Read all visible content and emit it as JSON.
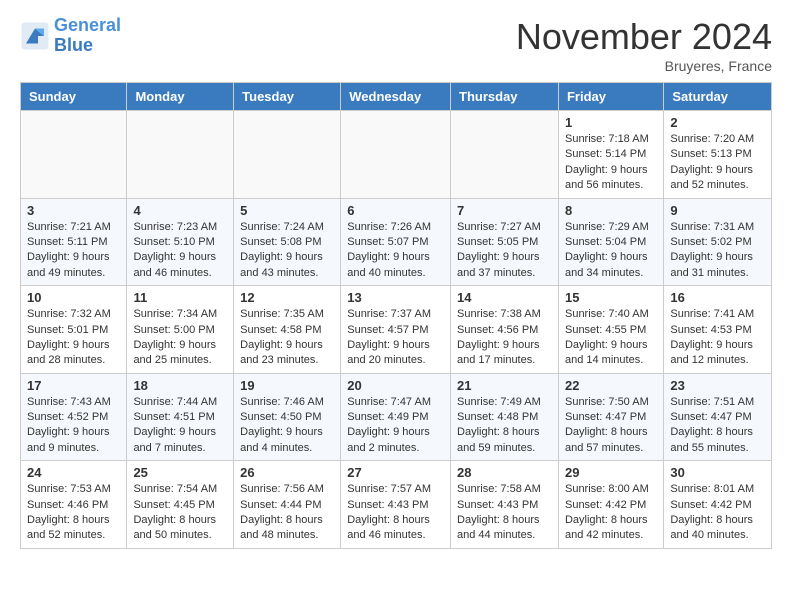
{
  "header": {
    "logo_line1": "General",
    "logo_line2": "Blue",
    "month": "November 2024",
    "location": "Bruyeres, France"
  },
  "weekdays": [
    "Sunday",
    "Monday",
    "Tuesday",
    "Wednesday",
    "Thursday",
    "Friday",
    "Saturday"
  ],
  "weeks": [
    [
      {
        "day": "",
        "info": ""
      },
      {
        "day": "",
        "info": ""
      },
      {
        "day": "",
        "info": ""
      },
      {
        "day": "",
        "info": ""
      },
      {
        "day": "",
        "info": ""
      },
      {
        "day": "1",
        "info": "Sunrise: 7:18 AM\nSunset: 5:14 PM\nDaylight: 9 hours and 56 minutes."
      },
      {
        "day": "2",
        "info": "Sunrise: 7:20 AM\nSunset: 5:13 PM\nDaylight: 9 hours and 52 minutes."
      }
    ],
    [
      {
        "day": "3",
        "info": "Sunrise: 7:21 AM\nSunset: 5:11 PM\nDaylight: 9 hours and 49 minutes."
      },
      {
        "day": "4",
        "info": "Sunrise: 7:23 AM\nSunset: 5:10 PM\nDaylight: 9 hours and 46 minutes."
      },
      {
        "day": "5",
        "info": "Sunrise: 7:24 AM\nSunset: 5:08 PM\nDaylight: 9 hours and 43 minutes."
      },
      {
        "day": "6",
        "info": "Sunrise: 7:26 AM\nSunset: 5:07 PM\nDaylight: 9 hours and 40 minutes."
      },
      {
        "day": "7",
        "info": "Sunrise: 7:27 AM\nSunset: 5:05 PM\nDaylight: 9 hours and 37 minutes."
      },
      {
        "day": "8",
        "info": "Sunrise: 7:29 AM\nSunset: 5:04 PM\nDaylight: 9 hours and 34 minutes."
      },
      {
        "day": "9",
        "info": "Sunrise: 7:31 AM\nSunset: 5:02 PM\nDaylight: 9 hours and 31 minutes."
      }
    ],
    [
      {
        "day": "10",
        "info": "Sunrise: 7:32 AM\nSunset: 5:01 PM\nDaylight: 9 hours and 28 minutes."
      },
      {
        "day": "11",
        "info": "Sunrise: 7:34 AM\nSunset: 5:00 PM\nDaylight: 9 hours and 25 minutes."
      },
      {
        "day": "12",
        "info": "Sunrise: 7:35 AM\nSunset: 4:58 PM\nDaylight: 9 hours and 23 minutes."
      },
      {
        "day": "13",
        "info": "Sunrise: 7:37 AM\nSunset: 4:57 PM\nDaylight: 9 hours and 20 minutes."
      },
      {
        "day": "14",
        "info": "Sunrise: 7:38 AM\nSunset: 4:56 PM\nDaylight: 9 hours and 17 minutes."
      },
      {
        "day": "15",
        "info": "Sunrise: 7:40 AM\nSunset: 4:55 PM\nDaylight: 9 hours and 14 minutes."
      },
      {
        "day": "16",
        "info": "Sunrise: 7:41 AM\nSunset: 4:53 PM\nDaylight: 9 hours and 12 minutes."
      }
    ],
    [
      {
        "day": "17",
        "info": "Sunrise: 7:43 AM\nSunset: 4:52 PM\nDaylight: 9 hours and 9 minutes."
      },
      {
        "day": "18",
        "info": "Sunrise: 7:44 AM\nSunset: 4:51 PM\nDaylight: 9 hours and 7 minutes."
      },
      {
        "day": "19",
        "info": "Sunrise: 7:46 AM\nSunset: 4:50 PM\nDaylight: 9 hours and 4 minutes."
      },
      {
        "day": "20",
        "info": "Sunrise: 7:47 AM\nSunset: 4:49 PM\nDaylight: 9 hours and 2 minutes."
      },
      {
        "day": "21",
        "info": "Sunrise: 7:49 AM\nSunset: 4:48 PM\nDaylight: 8 hours and 59 minutes."
      },
      {
        "day": "22",
        "info": "Sunrise: 7:50 AM\nSunset: 4:47 PM\nDaylight: 8 hours and 57 minutes."
      },
      {
        "day": "23",
        "info": "Sunrise: 7:51 AM\nSunset: 4:47 PM\nDaylight: 8 hours and 55 minutes."
      }
    ],
    [
      {
        "day": "24",
        "info": "Sunrise: 7:53 AM\nSunset: 4:46 PM\nDaylight: 8 hours and 52 minutes."
      },
      {
        "day": "25",
        "info": "Sunrise: 7:54 AM\nSunset: 4:45 PM\nDaylight: 8 hours and 50 minutes."
      },
      {
        "day": "26",
        "info": "Sunrise: 7:56 AM\nSunset: 4:44 PM\nDaylight: 8 hours and 48 minutes."
      },
      {
        "day": "27",
        "info": "Sunrise: 7:57 AM\nSunset: 4:43 PM\nDaylight: 8 hours and 46 minutes."
      },
      {
        "day": "28",
        "info": "Sunrise: 7:58 AM\nSunset: 4:43 PM\nDaylight: 8 hours and 44 minutes."
      },
      {
        "day": "29",
        "info": "Sunrise: 8:00 AM\nSunset: 4:42 PM\nDaylight: 8 hours and 42 minutes."
      },
      {
        "day": "30",
        "info": "Sunrise: 8:01 AM\nSunset: 4:42 PM\nDaylight: 8 hours and 40 minutes."
      }
    ]
  ]
}
